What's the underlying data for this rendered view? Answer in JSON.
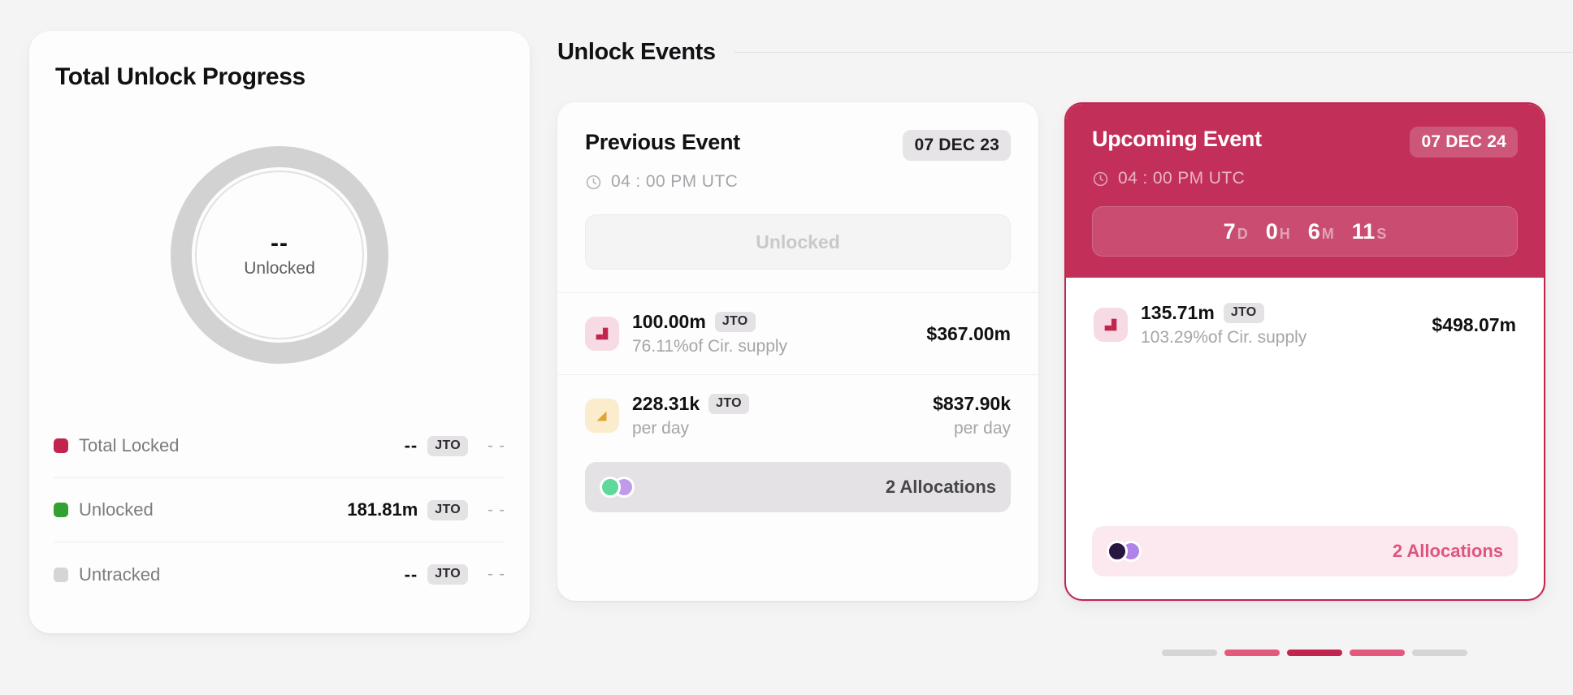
{
  "progress": {
    "title": "Total Unlock Progress",
    "donut": {
      "value": "--",
      "label": "Unlocked",
      "track_color": "#d2d2d2"
    },
    "legend": [
      {
        "name": "Total Locked",
        "color": "#c2244f",
        "amount": "--",
        "chip": "JTO",
        "usd": "- -"
      },
      {
        "name": "Unlocked",
        "color": "#33a033",
        "amount": "181.81m",
        "chip": "JTO",
        "usd": "- -"
      },
      {
        "name": "Untracked",
        "color": "#d6d4d6",
        "amount": "--",
        "chip": "JTO",
        "usd": "- -"
      }
    ]
  },
  "events": {
    "title": "Unlock Events",
    "previous": {
      "name": "Previous Event",
      "date": "07 DEC 23",
      "time": "04 : 00 PM UTC",
      "clock_icon": "clock-icon",
      "status_label": "Unlocked",
      "stats": [
        {
          "icon": "stairs-step-icon",
          "amount": "100.00m",
          "chip": "JTO",
          "sub": "76.11%of Cir. supply",
          "usd": "$367.00m",
          "usd_sub": ""
        },
        {
          "icon": "triangle-up-icon",
          "amount": "228.31k",
          "chip": "JTO",
          "sub": "per day",
          "usd": "$837.90k",
          "usd_sub": "per day"
        }
      ],
      "allocations": {
        "text": "2 Allocations",
        "dot1_color": "#5fd89a",
        "dot2_color": "#bf9bec"
      }
    },
    "upcoming": {
      "name": "Upcoming Event",
      "date": "07 DEC 24",
      "time": "04 : 00 PM UTC",
      "clock_icon": "clock-icon",
      "countdown": [
        {
          "value": "7",
          "unit": "D"
        },
        {
          "value": "0",
          "unit": "H"
        },
        {
          "value": "6",
          "unit": "M"
        },
        {
          "value": "11",
          "unit": "S"
        }
      ],
      "stats": [
        {
          "icon": "stairs-step-icon",
          "amount": "135.71m",
          "chip": "JTO",
          "sub": "103.29%of Cir. supply",
          "usd": "$498.07m",
          "usd_sub": ""
        }
      ],
      "allocations": {
        "text": "2 Allocations",
        "dot1_color": "#27163f",
        "dot2_color": "#b183e8"
      }
    }
  },
  "pagination": {
    "bars": [
      "inactive",
      "pink",
      "active",
      "pink",
      "inactive"
    ]
  },
  "theme": {
    "accent": "#c2244f",
    "accent_header": "#c2305a",
    "pink": "#e3597e",
    "green": "#33a033"
  }
}
